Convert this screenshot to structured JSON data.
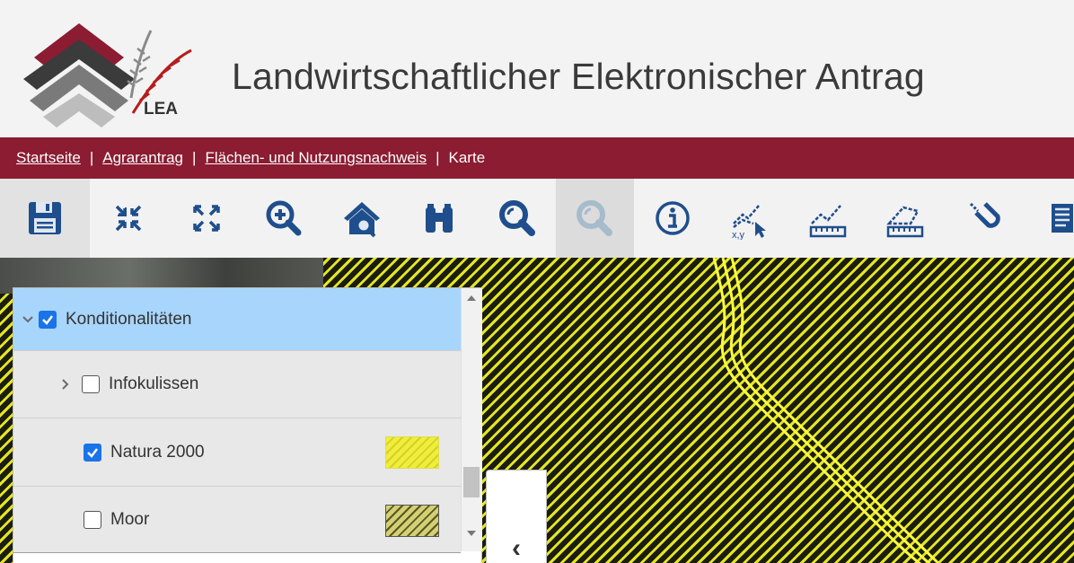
{
  "app": {
    "logo_text": "LEA",
    "title": "Landwirtschaftlicher Elektronischer Antrag"
  },
  "breadcrumb": {
    "items": [
      {
        "label": "Startseite",
        "link": true
      },
      {
        "label": "Agrarantrag",
        "link": true
      },
      {
        "label": "Flächen- und Nutzungsnachweis",
        "link": true
      },
      {
        "label": "Karte",
        "link": false
      }
    ]
  },
  "toolbar": {
    "icons": [
      "save-icon",
      "collapse-arrows-icon",
      "expand-arrows-icon",
      "zoom-in-icon",
      "home-zoom-icon",
      "binoculars-icon",
      "zoom-search-icon",
      "zoom-search-disabled-icon",
      "info-icon",
      "xy-coordinate-icon",
      "measure-line-icon",
      "measure-area-icon",
      "magnet-snap-icon",
      "print-icon"
    ]
  },
  "layers": {
    "rows": [
      {
        "label": "Konditionalitäten",
        "checked": true,
        "expander": "open"
      },
      {
        "label": "Infokulissen",
        "checked": false,
        "expander": "closed"
      },
      {
        "label": "Natura 2000",
        "checked": true,
        "swatch": "yellow-hatch"
      },
      {
        "label": "Moor",
        "checked": false,
        "swatch": "olive-hatch"
      }
    ]
  },
  "colors": {
    "header_bg": "#f3f3f3",
    "crumb_bar": "#8b1c31",
    "toolbar_icon": "#1f4e8c",
    "selected_row": "#a8d5fb",
    "map_hatch_yellow": "#e4e622"
  }
}
